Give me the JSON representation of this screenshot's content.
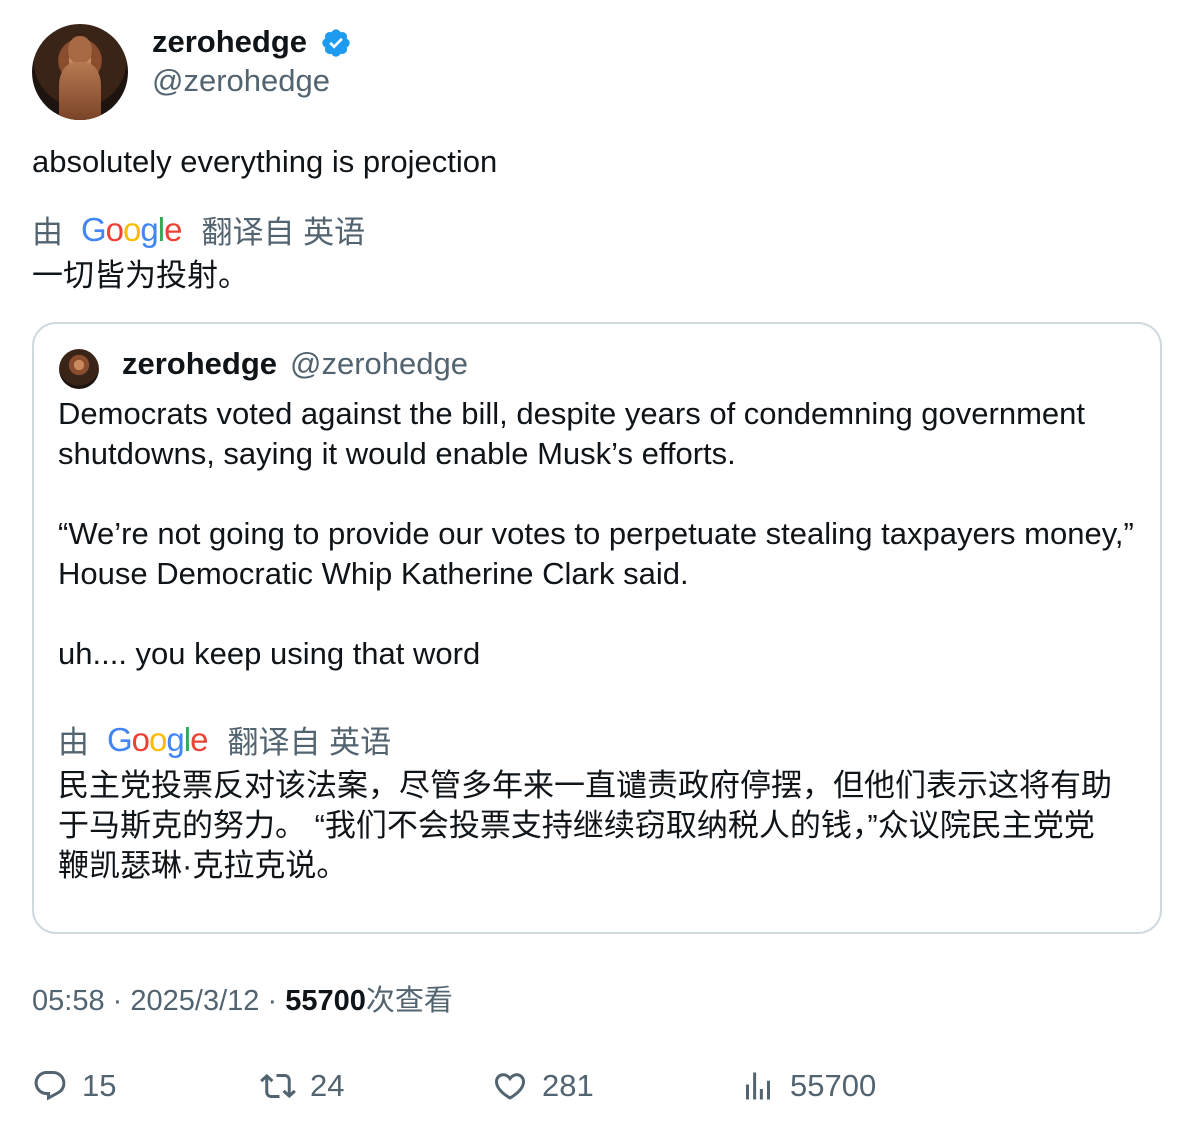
{
  "tweet": {
    "author": {
      "name": "zerohedge",
      "handle": "@zerohedge",
      "verified": true
    },
    "text": "absolutely everything is projection",
    "translation": {
      "by": "由",
      "provider": "Google",
      "from_label": "翻译自 英语",
      "text": "一切皆为投射。"
    },
    "quoted": {
      "author": {
        "name": "zerohedge",
        "handle": "@zerohedge"
      },
      "paragraphs": [
        "Democrats voted against the bill, despite years of condemning government shutdowns, saying it would enable Musk’s efforts.",
        "“We’re not going to provide our votes to perpetuate stealing taxpayers money,” House Democratic Whip Katherine Clark said.",
        "uh.... you keep using that word"
      ],
      "translation": {
        "by": "由",
        "provider": "Google",
        "from_label": "翻译自 英语",
        "text": "民主党投票反对该法案，尽管多年来一直谴责政府停摆，但他们表示这将有助于马斯克的努力。 “我们不会投票支持继续窃取纳税人的钱，”众议院民主党党鞭凯瑟琳·克拉克说。"
      }
    },
    "meta": {
      "time": "05:58",
      "separator": "·",
      "date": "2025/3/12",
      "views": "55700",
      "views_label": "次查看"
    },
    "actions": {
      "replies": "15",
      "retweets": "24",
      "likes": "281",
      "views": "55700"
    }
  },
  "colors": {
    "text": "#0f1419",
    "muted": "#536471",
    "border": "#cfd9de",
    "verified": "#1d9bf0"
  }
}
